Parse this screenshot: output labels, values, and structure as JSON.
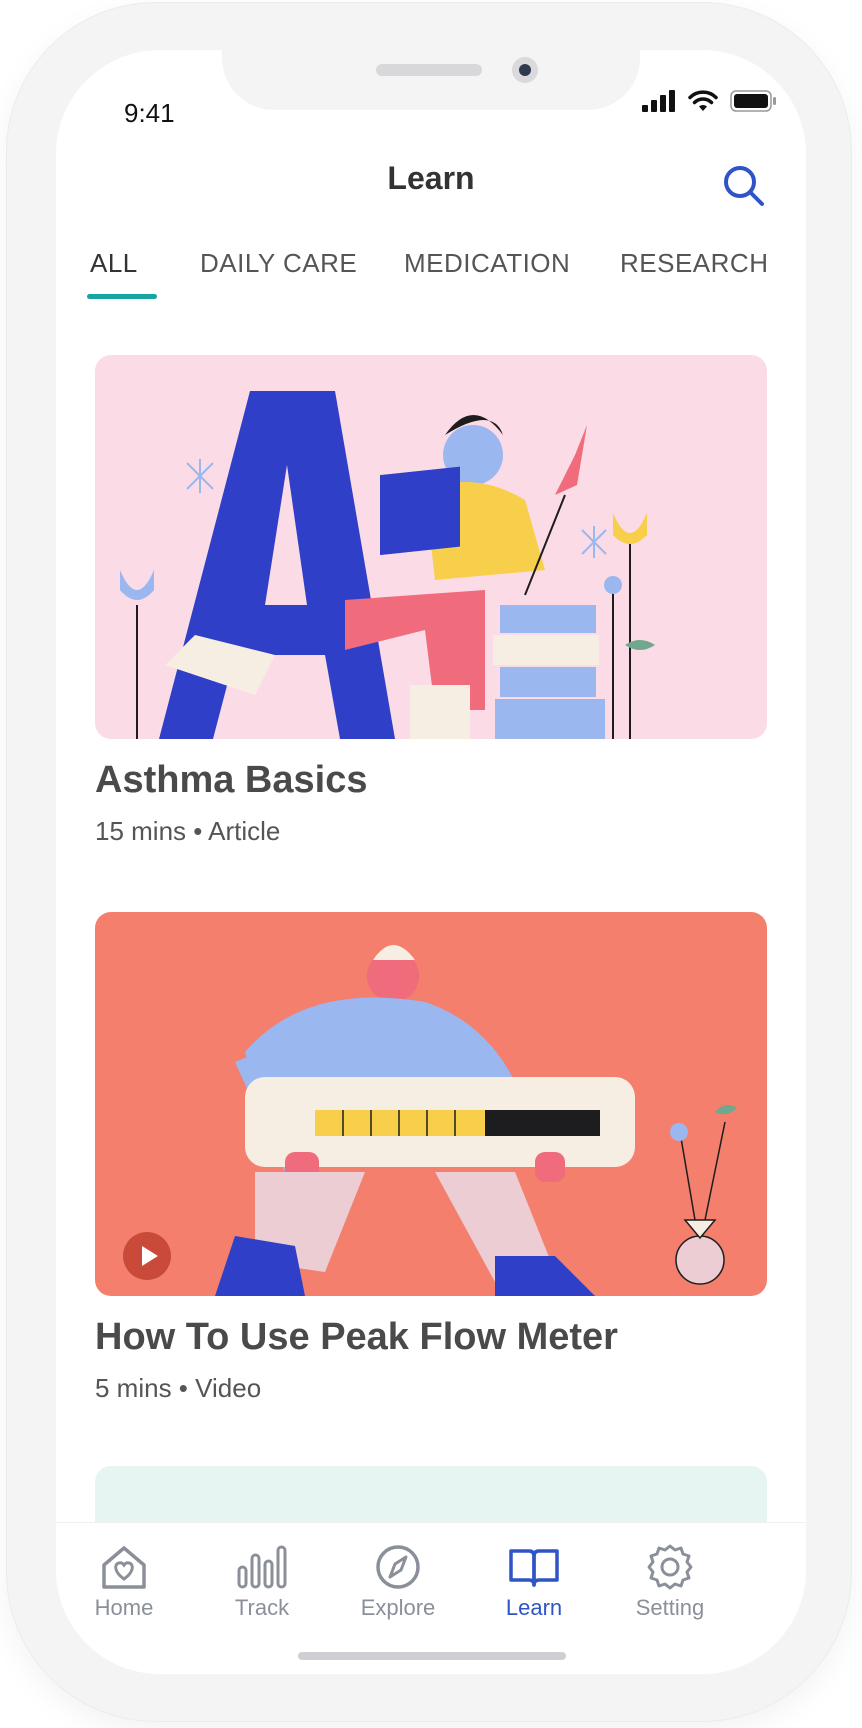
{
  "status_bar": {
    "time": "9:41"
  },
  "header": {
    "title": "Learn"
  },
  "tabs": [
    {
      "label": "ALL",
      "active": true
    },
    {
      "label": "DAILY CARE",
      "active": false
    },
    {
      "label": "MEDICATION",
      "active": false
    },
    {
      "label": "RESEARCH",
      "active": false
    }
  ],
  "cards": [
    {
      "title": "Asthma Basics",
      "meta": "15 mins • Article",
      "image_bg": "#fbdbe6",
      "type_icon": "none"
    },
    {
      "title": "How To Use Peak Flow Meter",
      "meta": "5 mins • Video",
      "image_bg": "#f47f6c",
      "type_icon": "play-icon"
    }
  ],
  "bottom_nav": [
    {
      "label": "Home",
      "icon": "home-heart-icon",
      "active": false
    },
    {
      "label": "Track",
      "icon": "bar-chart-icon",
      "active": false
    },
    {
      "label": "Explore",
      "icon": "compass-icon",
      "active": false
    },
    {
      "label": "Learn",
      "icon": "book-open-icon",
      "active": true
    },
    {
      "label": "Setting",
      "icon": "gear-icon",
      "active": false
    }
  ],
  "colors": {
    "accent": "#15a5a5",
    "primary": "#2f54c7",
    "card1_bg": "#fbdbe6",
    "card2_bg": "#f47f6c",
    "card3_bg": "#e6f4f2"
  }
}
